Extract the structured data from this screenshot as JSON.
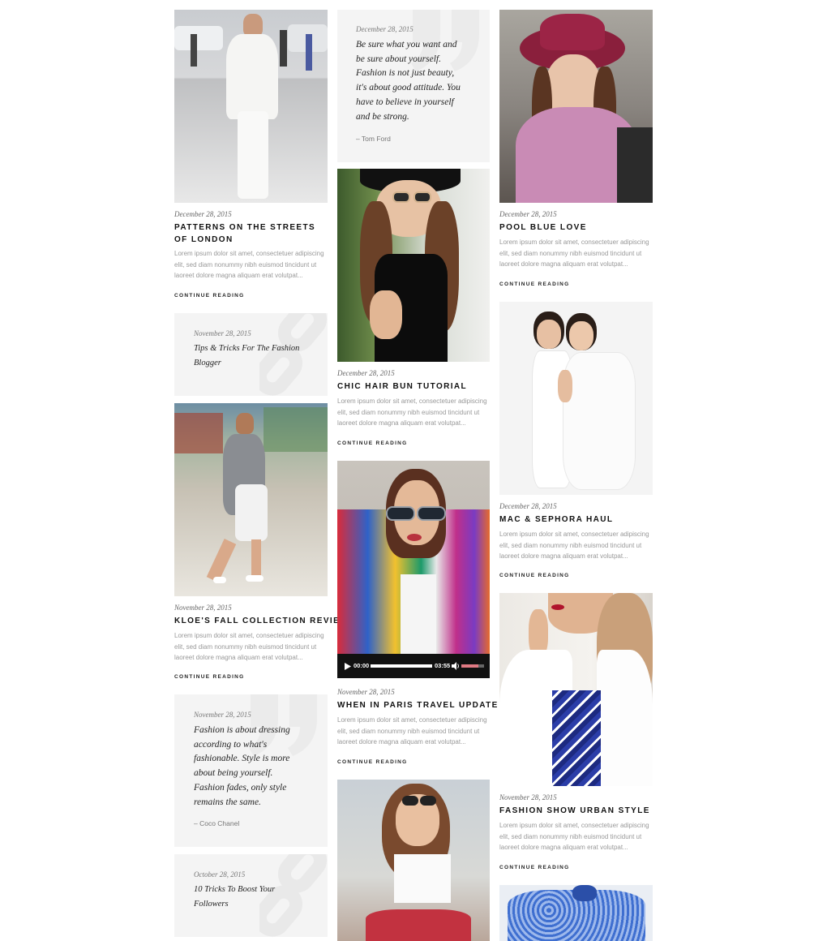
{
  "posts": [
    {
      "date": "December 28, 2015",
      "title": "Patterns on the streets of London",
      "excerpt": "Lorem ipsum dolor sit amet, consectetuer adipiscing elit, sed diam nonummy nibh euismod tincidunt ut laoreet dolore magna aliquam erat volutpat...",
      "more": "CONTINUE READING"
    },
    {
      "date": "November 28, 2015",
      "title": "Kloe's fall collection review",
      "excerpt": "Lorem ipsum dolor sit amet, consectetuer adipiscing elit, sed diam nonummy nibh euismod tincidunt ut laoreet dolore magna aliquam erat volutpat...",
      "more": "CONTINUE READING"
    },
    {
      "date": "December 28, 2015",
      "title": "Chic hair bun tutorial",
      "excerpt": "Lorem ipsum dolor sit amet, consectetuer adipiscing elit, sed diam nonummy nibh euismod tincidunt ut laoreet dolore magna aliquam erat volutpat...",
      "more": "CONTINUE READING"
    },
    {
      "date": "November 28, 2015",
      "title": "When in Paris travel update",
      "excerpt": "Lorem ipsum dolor sit amet, consectetuer adipiscing elit, sed diam nonummy nibh euismod tincidunt ut laoreet dolore magna aliquam erat volutpat...",
      "more": "CONTINUE READING"
    },
    {
      "date": "December 28, 2015",
      "title": "Pool blue love",
      "excerpt": "Lorem ipsum dolor sit amet, consectetuer adipiscing elit, sed diam nonummy nibh euismod tincidunt ut laoreet dolore magna aliquam erat volutpat...",
      "more": "CONTINUE READING"
    },
    {
      "date": "December 28, 2015",
      "title": "MAC & Sephora haul",
      "excerpt": "Lorem ipsum dolor sit amet, consectetuer adipiscing elit, sed diam nonummy nibh euismod tincidunt ut laoreet dolore magna aliquam erat volutpat...",
      "more": "CONTINUE READING"
    },
    {
      "date": "November 28, 2015",
      "title": "Fashion show urban style",
      "excerpt": "Lorem ipsum dolor sit amet, consectetuer adipiscing elit, sed diam nonummy nibh euismod tincidunt ut laoreet dolore magna aliquam erat volutpat...",
      "more": "CONTINUE READING"
    }
  ],
  "quotes": [
    {
      "date": "December 28, 2015",
      "lines": [
        "Be sure what you want and",
        "be sure about yourself.",
        "Fashion is not just beauty,",
        "it's about good attitude. You",
        "have to believe in yourself",
        "and be strong."
      ],
      "author": "– Tom Ford"
    },
    {
      "date": "November 28, 2015",
      "lines": [
        "Fashion is about dressing",
        "according to what's",
        "fashionable. Style is more",
        "about being yourself.",
        "Fashion fades, only style",
        "remains the same."
      ],
      "author": "– Coco Chanel"
    }
  ],
  "links": [
    {
      "date": "November 28, 2015",
      "lines": [
        "Tips & Tricks For The Fashion",
        "Blogger"
      ]
    },
    {
      "date": "October 28, 2015",
      "lines": [
        "10 Tricks To Boost Your",
        "Followers"
      ]
    }
  ],
  "player": {
    "current_time": "00:00",
    "duration": "03:55",
    "progress": 0,
    "volume": 0.75
  }
}
